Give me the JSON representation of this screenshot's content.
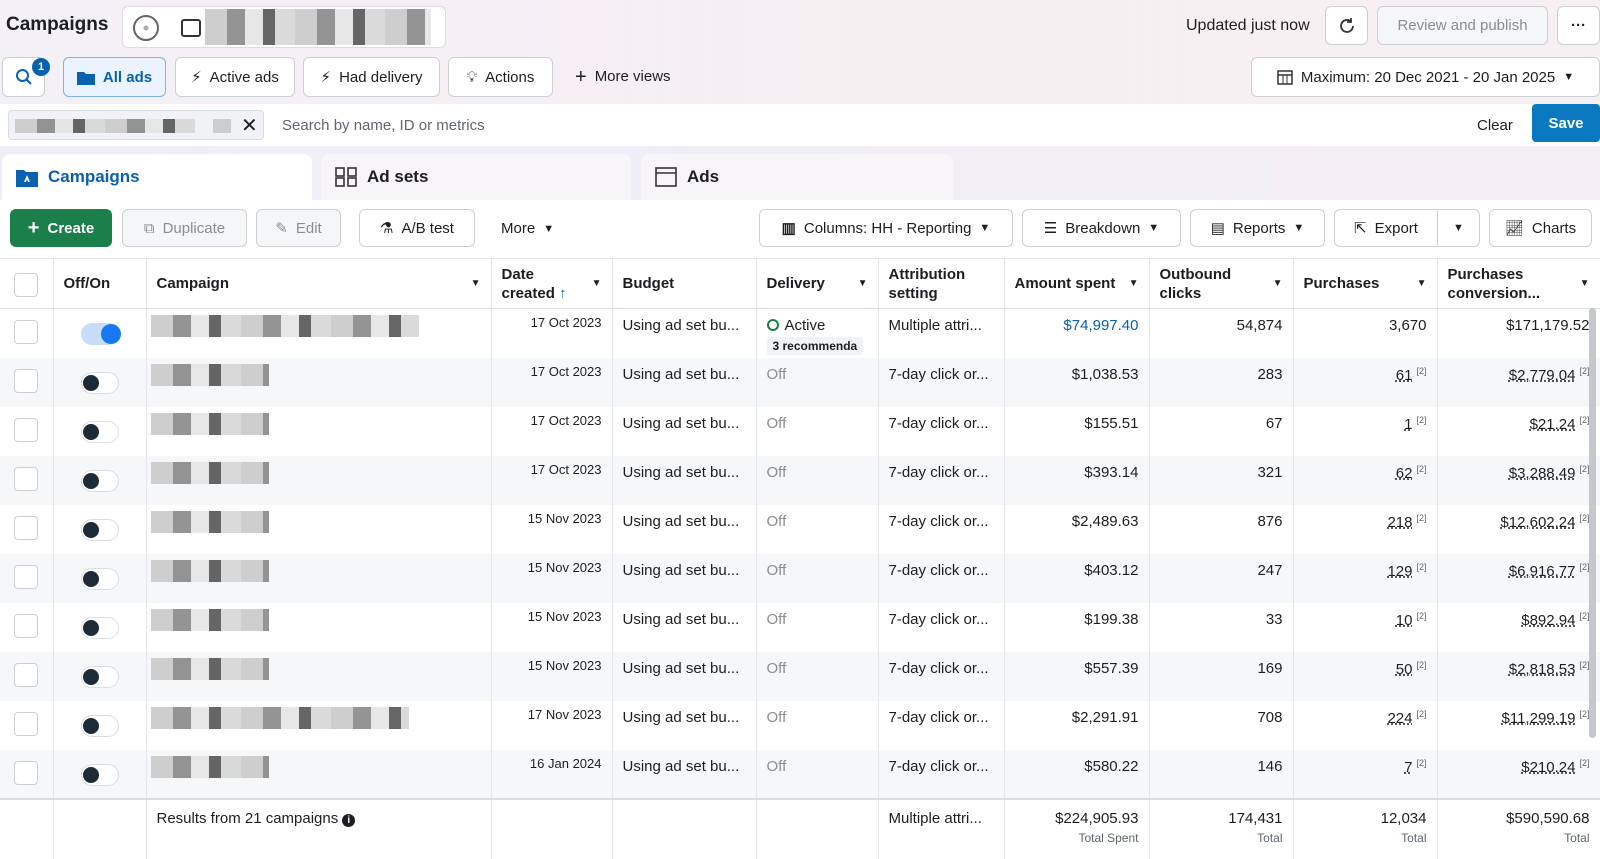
{
  "header": {
    "title": "Campaigns",
    "updated": "Updated just now",
    "review_publish": "Review and publish",
    "more": "···"
  },
  "views": {
    "search_badge": "1",
    "all_ads": "All ads",
    "active_ads": "Active ads",
    "had_delivery": "Had delivery",
    "actions": "Actions",
    "more_views": "More views",
    "date_range": "Maximum: 20 Dec 2021 - 20 Jan 2025"
  },
  "search": {
    "placeholder": "Search by name, ID or metrics",
    "clear": "Clear",
    "save": "Save"
  },
  "tabs": [
    "Campaigns",
    "Ad sets",
    "Ads"
  ],
  "toolbar": {
    "create": "Create",
    "duplicate": "Duplicate",
    "edit": "Edit",
    "ab_test": "A/B test",
    "more": "More",
    "columns": "Columns: HH - Reporting",
    "breakdown": "Breakdown",
    "reports": "Reports",
    "export": "Export",
    "charts": "Charts"
  },
  "columns": {
    "offon": "Off/On",
    "campaign": "Campaign",
    "date_created": "Date created",
    "budget": "Budget",
    "delivery": "Delivery",
    "attribution": "Attribution setting",
    "amount_spent": "Amount spent",
    "outbound_clicks": "Outbound clicks",
    "purchases": "Purchases",
    "purchases_conversion": "Purchases conversion..."
  },
  "rows": [
    {
      "date": "17 Oct 2023",
      "budget": "Using ad set bu...",
      "delivery": "Active",
      "recs": "3 recommenda",
      "attribution": "Multiple attri...",
      "spent": "$74,997.40",
      "clicks": "54,874",
      "purchases": "3,670",
      "conversion": "$171,179.52",
      "on": true
    },
    {
      "date": "17 Oct 2023",
      "budget": "Using ad set bu...",
      "delivery": "Off",
      "attribution": "7-day click or...",
      "spent": "$1,038.53",
      "clicks": "283",
      "purchases": "61",
      "conversion": "$2,779.04",
      "note": "[2]"
    },
    {
      "date": "17 Oct 2023",
      "budget": "Using ad set bu...",
      "delivery": "Off",
      "attribution": "7-day click or...",
      "spent": "$155.51",
      "clicks": "67",
      "purchases": "1",
      "conversion": "$21.24",
      "note": "[2]"
    },
    {
      "date": "17 Oct 2023",
      "budget": "Using ad set bu...",
      "delivery": "Off",
      "attribution": "7-day click or...",
      "spent": "$393.14",
      "clicks": "321",
      "purchases": "62",
      "conversion": "$3,288.49",
      "note": "[2]"
    },
    {
      "date": "15 Nov 2023",
      "budget": "Using ad set bu...",
      "delivery": "Off",
      "attribution": "7-day click or...",
      "spent": "$2,489.63",
      "clicks": "876",
      "purchases": "218",
      "conversion": "$12,602.24",
      "note": "[2]"
    },
    {
      "date": "15 Nov 2023",
      "budget": "Using ad set bu...",
      "delivery": "Off",
      "attribution": "7-day click or...",
      "spent": "$403.12",
      "clicks": "247",
      "purchases": "129",
      "conversion": "$6,916.77",
      "note": "[2]"
    },
    {
      "date": "15 Nov 2023",
      "budget": "Using ad set bu...",
      "delivery": "Off",
      "attribution": "7-day click or...",
      "spent": "$199.38",
      "clicks": "33",
      "purchases": "10",
      "conversion": "$892.94",
      "note": "[2]"
    },
    {
      "date": "15 Nov 2023",
      "budget": "Using ad set bu...",
      "delivery": "Off",
      "attribution": "7-day click or...",
      "spent": "$557.39",
      "clicks": "169",
      "purchases": "50",
      "conversion": "$2,818.53",
      "note": "[2]"
    },
    {
      "date": "17 Nov 2023",
      "budget": "Using ad set bu...",
      "delivery": "Off",
      "attribution": "7-day click or...",
      "spent": "$2,291.91",
      "clicks": "708",
      "purchases": "224",
      "conversion": "$11,299.19",
      "note": "[2]"
    },
    {
      "date": "16 Jan 2024",
      "budget": "Using ad set bu...",
      "delivery": "Off",
      "attribution": "7-day click or...",
      "spent": "$580.22",
      "clicks": "146",
      "purchases": "7",
      "conversion": "$210.24",
      "note": "[2]"
    }
  ],
  "footer": {
    "results": "Results from 21 campaigns",
    "attribution": "Multiple attri...",
    "spent": "$224,905.93",
    "spent_sub": "Total Spent",
    "clicks": "174,431",
    "clicks_sub": "Total",
    "purchases": "12,034",
    "purchases_sub": "Total",
    "conversion": "$590,590.68",
    "conversion_sub": "Total"
  },
  "icons": {
    "search": "search-icon",
    "refresh": "refresh-icon",
    "folder": "folder-icon",
    "bolt": "lightning-icon",
    "bulb": "lightbulb-icon",
    "calendar": "calendar-icon",
    "close": "close-icon"
  },
  "colors": {
    "accent": "#0a78be",
    "create": "#1a7f4b",
    "link": "#0a61b0"
  }
}
